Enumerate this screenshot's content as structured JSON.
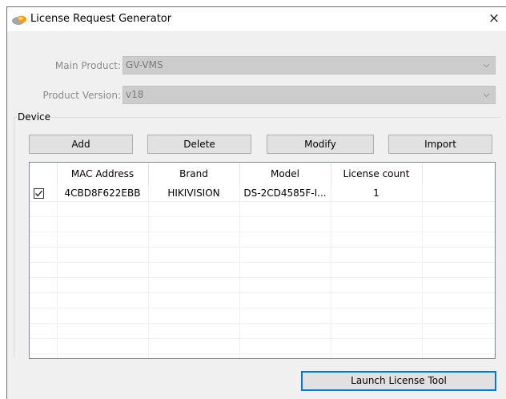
{
  "window": {
    "title": "License Request Generator",
    "close_glyph": "×",
    "icon": "license-app-icon"
  },
  "form": {
    "main_product_label": "Main Product:",
    "main_product_value": "GV-VMS",
    "product_version_label": "Product Version:",
    "product_version_value": "v18"
  },
  "device": {
    "group_label": "Device",
    "buttons": {
      "add": "Add",
      "delete": "Delete",
      "modify": "Modify",
      "import": "Import"
    },
    "columns": [
      "MAC Address",
      "Brand",
      "Model",
      "License count"
    ],
    "rows": [
      {
        "checked": true,
        "mac": "4CBD8F622EBB",
        "brand": "HIKIVISION",
        "model": "DS-2CD4585F-I...",
        "license_count": "1"
      }
    ]
  },
  "footer": {
    "launch_label": "Launch License Tool"
  },
  "colors": {
    "window_bg": "#f0f0f0",
    "disabled_field": "#cccccc",
    "focus_border": "#0078d7"
  }
}
